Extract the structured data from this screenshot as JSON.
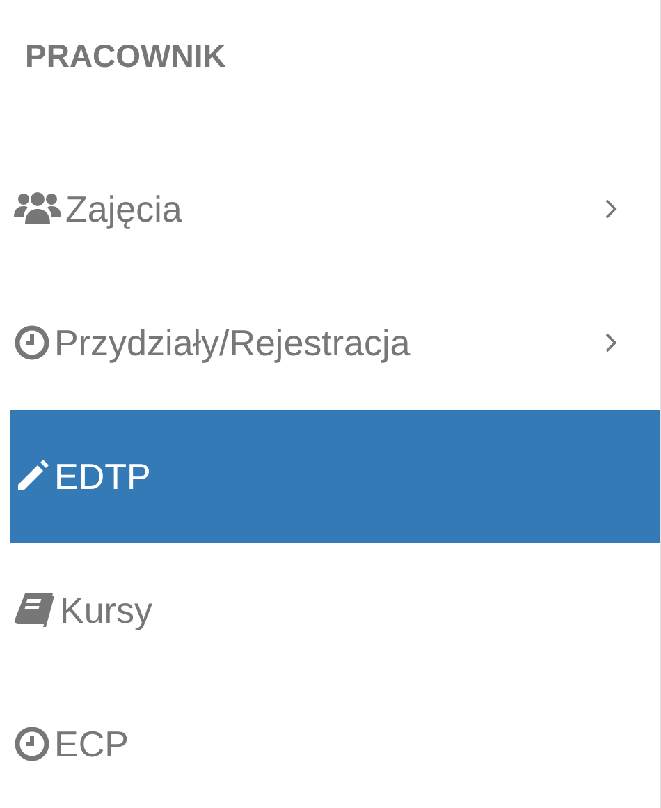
{
  "sidebar": {
    "heading": "PRACOWNIK",
    "items": [
      {
        "label": "Zajęcia",
        "expandable": true,
        "selected": false
      },
      {
        "label": "Przydziały/Rejestracja",
        "expandable": true,
        "selected": false
      },
      {
        "label": "EDTP",
        "expandable": false,
        "selected": true
      },
      {
        "label": "Kursy",
        "expandable": false,
        "selected": false
      },
      {
        "label": "ECP",
        "expandable": false,
        "selected": false
      }
    ]
  }
}
